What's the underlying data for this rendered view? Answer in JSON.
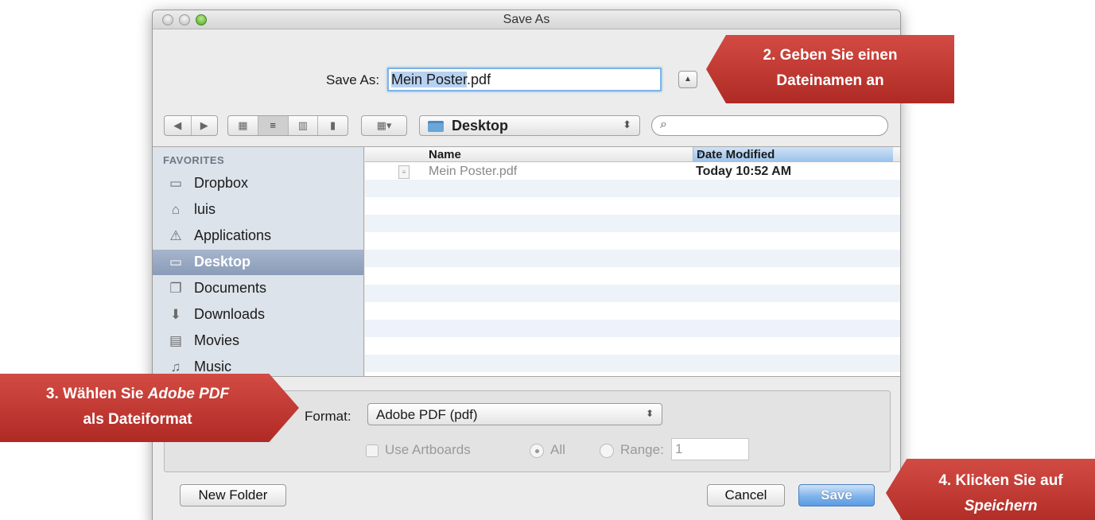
{
  "window": {
    "title": "Save As"
  },
  "save_as": {
    "label": "Save As:",
    "filename_selected": "Mein Poster",
    "filename_ext": ".pdf",
    "expand_icon": "triangle-up-icon"
  },
  "toolbar": {
    "nav_back_icon": "◀",
    "nav_forward_icon": "▶",
    "views": [
      "▦",
      "≡",
      "▥",
      "▮"
    ],
    "arrange_icon": "▦▾",
    "location": "Desktop",
    "location_arrows": "⬍",
    "search_glyph": "⌕",
    "search_placeholder": ""
  },
  "sidebar": {
    "heading": "FAVORITES",
    "items": [
      {
        "label": "Dropbox",
        "icon": "▭",
        "selected": false
      },
      {
        "label": "luis",
        "icon": "⌂",
        "selected": false
      },
      {
        "label": "Applications",
        "icon": "⚠",
        "selected": false
      },
      {
        "label": "Desktop",
        "icon": "▭",
        "selected": true
      },
      {
        "label": "Documents",
        "icon": "❐",
        "selected": false
      },
      {
        "label": "Downloads",
        "icon": "⬇",
        "selected": false
      },
      {
        "label": "Movies",
        "icon": "▤",
        "selected": false
      },
      {
        "label": "Music",
        "icon": "♫",
        "selected": false
      }
    ]
  },
  "file_list": {
    "col_name": "Name",
    "col_date": "Date Modified",
    "sort_icon": "▼",
    "files": [
      {
        "name": "Mein Poster.pdf",
        "date": "Today 10:52 AM",
        "icon": "≡"
      }
    ]
  },
  "options": {
    "format_label": "Format:",
    "format_value": "Adobe PDF (pdf)",
    "format_arrows": "⬍",
    "use_artboards": "Use Artboards",
    "all": "All",
    "range": "Range:",
    "range_value": "1"
  },
  "buttons": {
    "new_folder": "New Folder",
    "cancel": "Cancel",
    "save": "Save"
  },
  "callouts": {
    "step2_line1": "2. Geben Sie einen",
    "step2_line2": "Dateinamen an",
    "step3_line1a": "3. Wählen Sie ",
    "step3_line1b": "Adobe PDF",
    "step3_line2": "als Dateiformat",
    "step4_line1": "4. Klicken Sie auf",
    "step4_line2": "Speichern"
  },
  "colors": {
    "callout_red": "#c13a33",
    "selection_blue": "#b7d2f1",
    "sidebar_bg": "#dde3ea"
  }
}
